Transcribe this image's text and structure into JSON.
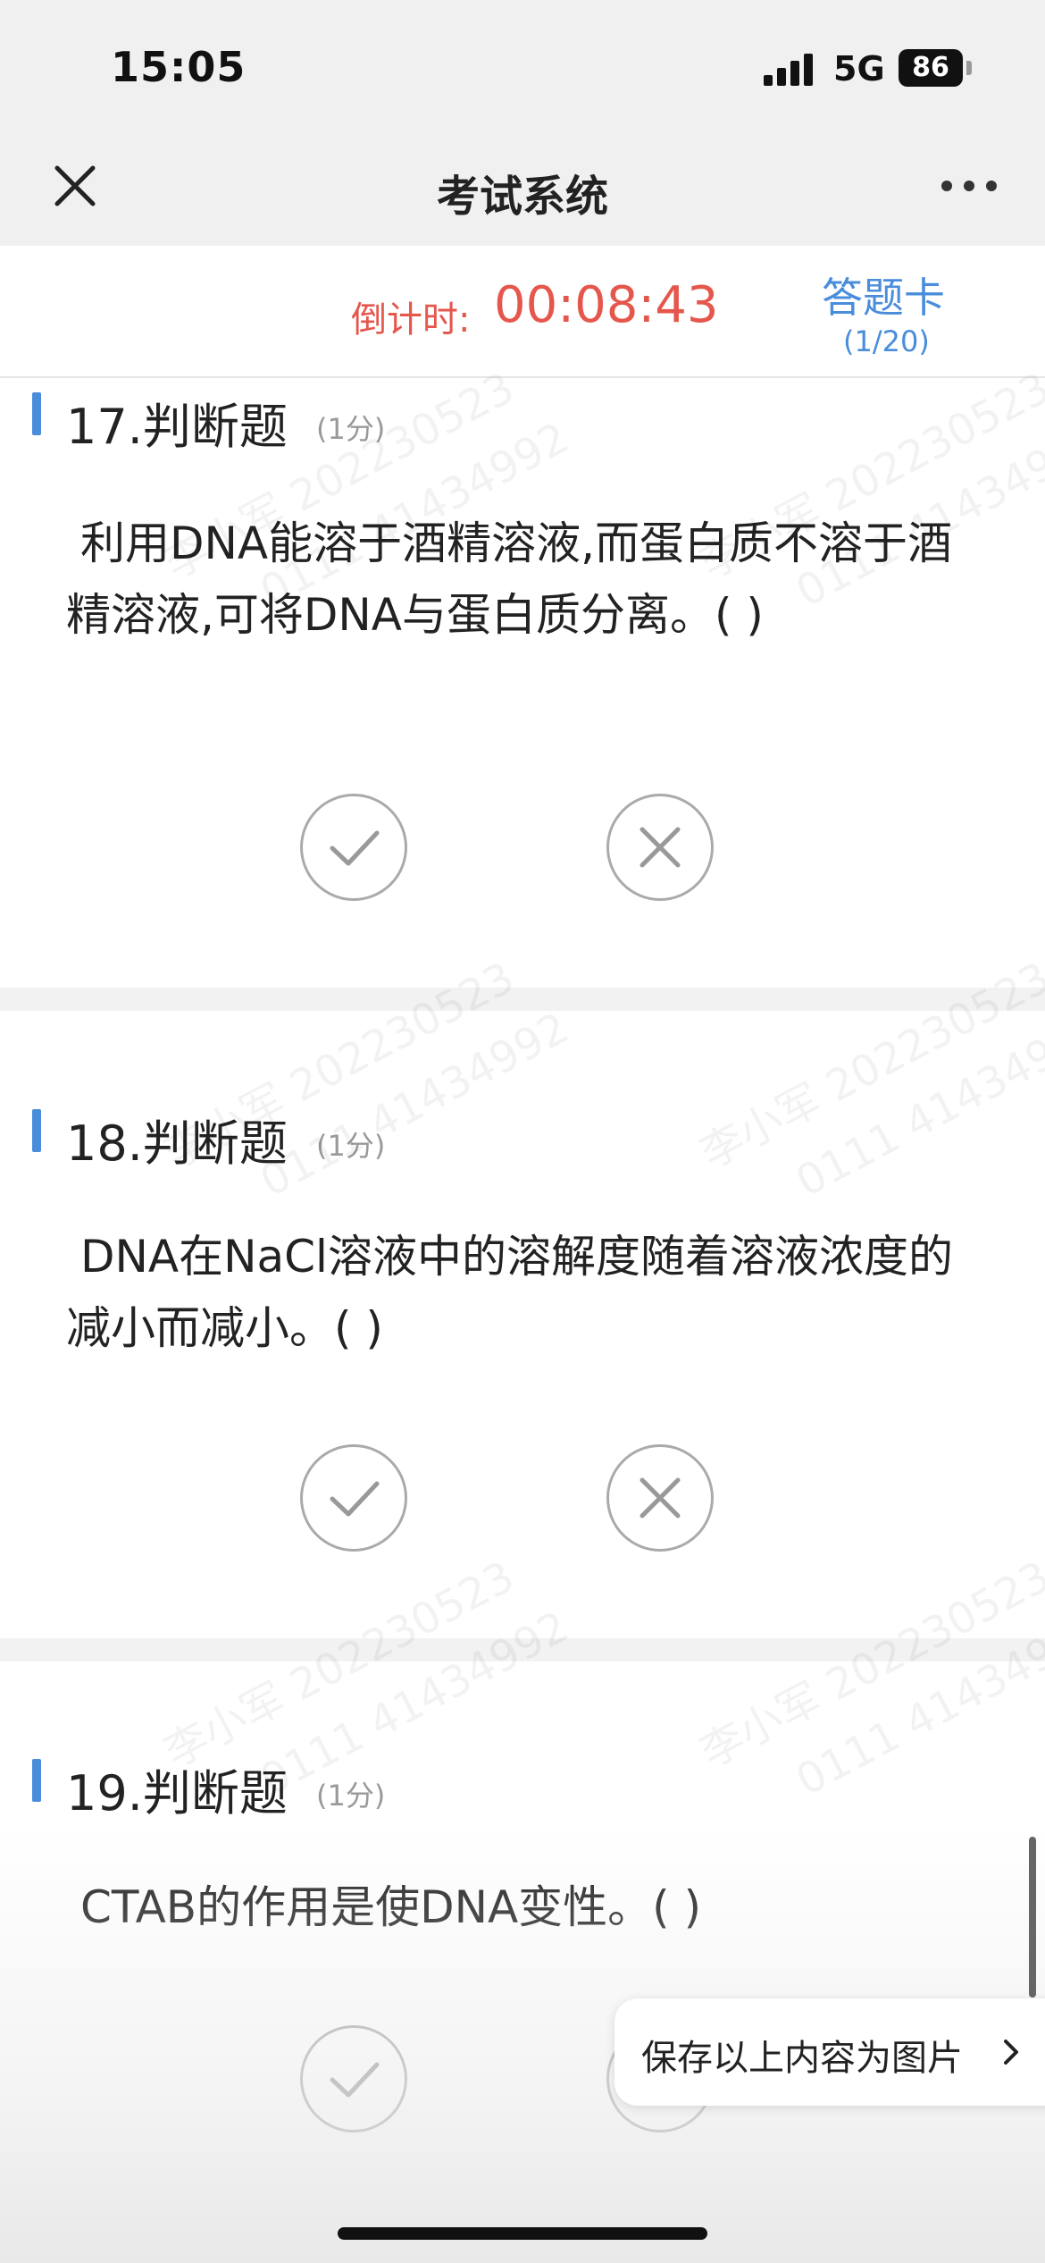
{
  "status": {
    "time": "15:05",
    "network": "5G",
    "battery": "86"
  },
  "nav": {
    "title": "考试系统",
    "close_icon": "close-icon",
    "more_icon": "more-icon"
  },
  "timer": {
    "label": "倒计时:",
    "value": "00:08:43"
  },
  "answer_card": {
    "label": "答题卡",
    "progress": "(1/20)"
  },
  "watermark": {
    "line1": "李小军 202230523",
    "line2": "0111 41434992"
  },
  "questions": [
    {
      "title": "17.判断题",
      "score": "(1分)",
      "text": "利用DNA能溶于酒精溶液,而蛋白质不溶于酒精溶液,可将DNA与蛋白质分离。(    )"
    },
    {
      "title": "18.判断题",
      "score": "(1分)",
      "text": "DNA在NaCl溶液中的溶解度随着溶液浓度的减小而减小。(    )"
    },
    {
      "title": "19.判断题",
      "score": "(1分)",
      "text": "CTAB的作用是使DNA变性。(    )"
    }
  ],
  "options": {
    "true_icon": "check-icon",
    "false_icon": "cross-icon"
  },
  "save_button": {
    "label": "保存以上内容为图片"
  },
  "colors": {
    "accent": "#4a8ddb",
    "timer": "#e5574c",
    "header_bg": "#f0f0f0"
  }
}
